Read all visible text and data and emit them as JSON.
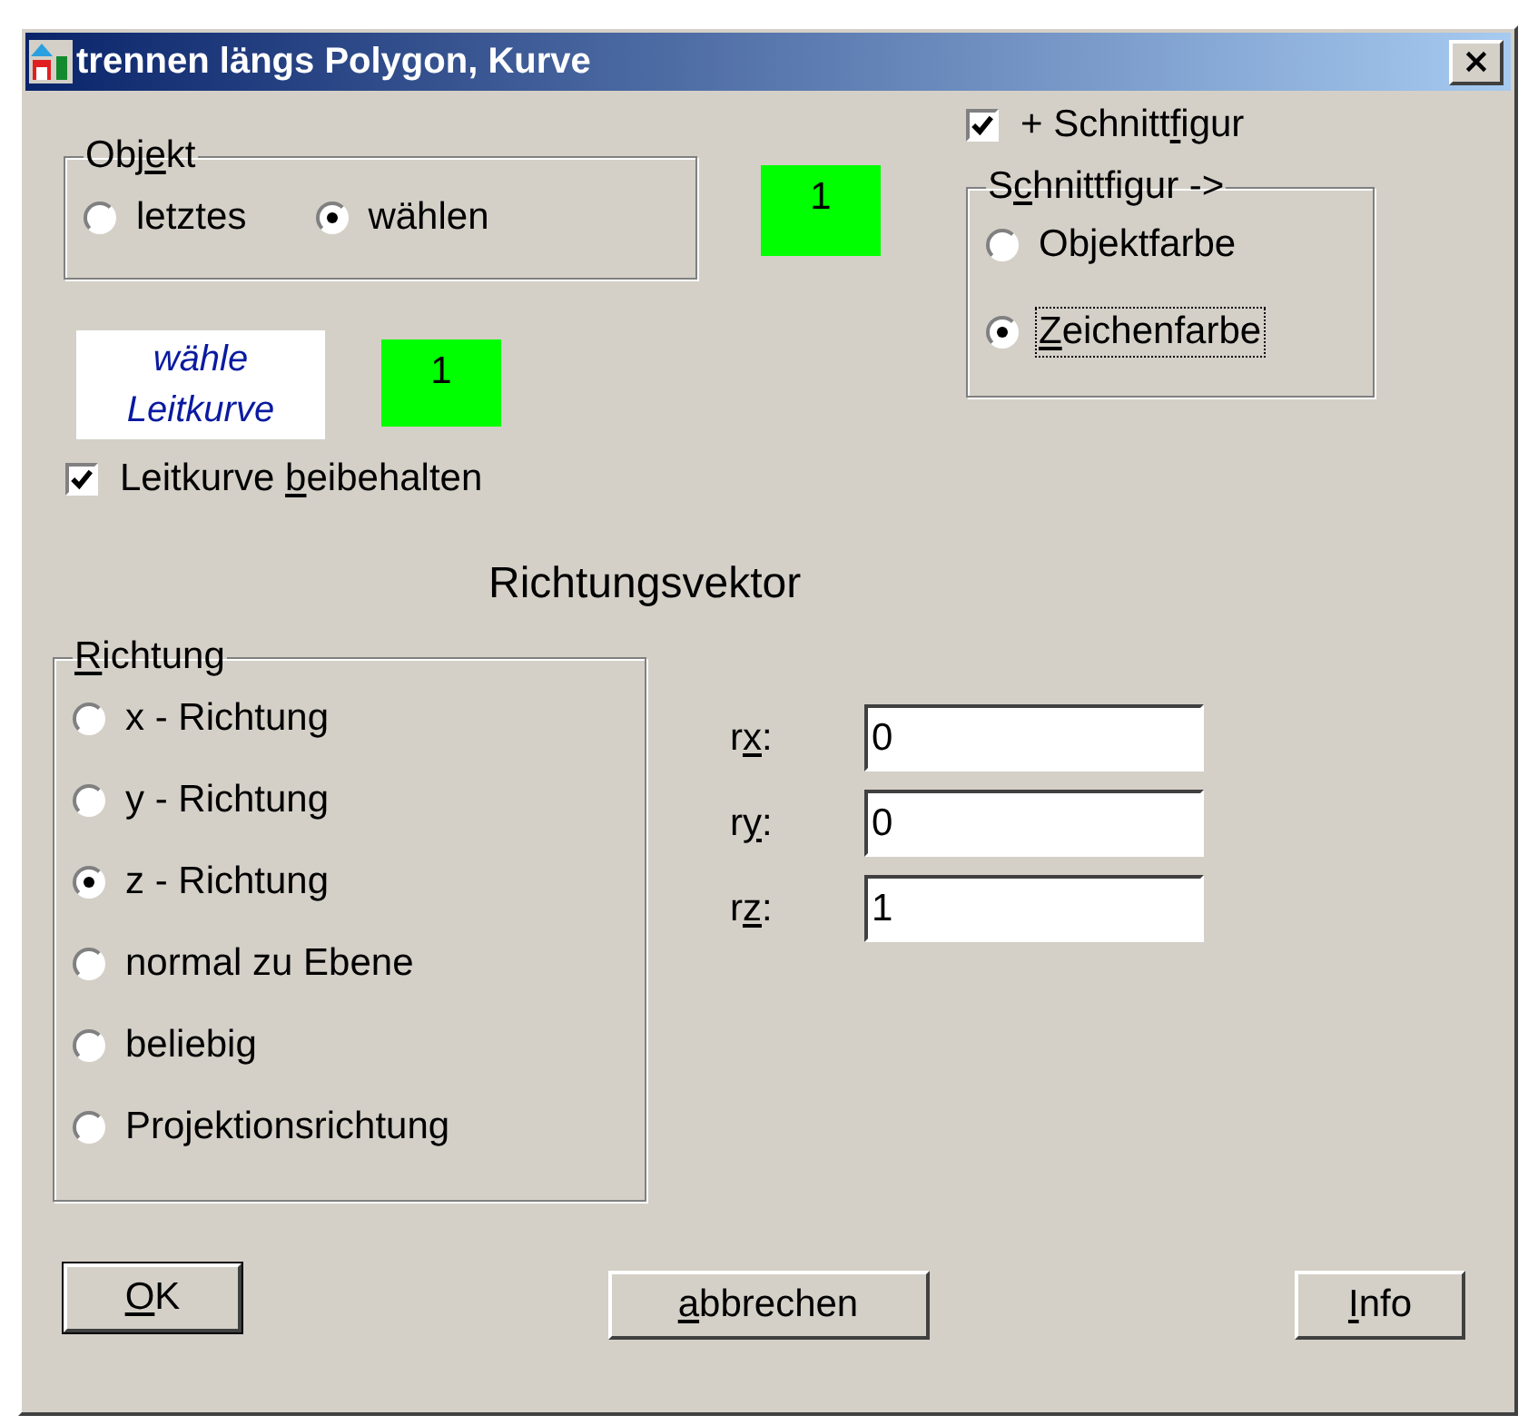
{
  "window": {
    "title": "trennen längs Polygon, Kurve"
  },
  "objekt_group": {
    "label": [
      "Obj",
      "e",
      "kt"
    ],
    "options": [
      {
        "label": "letztes",
        "selected": false
      },
      {
        "label": "wählen",
        "selected": true
      }
    ]
  },
  "objekt_count": "1",
  "leitkurve_prompt": [
    "wähle",
    "Leitkurve"
  ],
  "leitkurve_count": "1",
  "keep_leitkurve": {
    "label": [
      "Leitkurve ",
      "b",
      "eibehalten"
    ],
    "checked": true
  },
  "schnittfigur": {
    "label": [
      "+ Schnitt",
      "f",
      "igur"
    ],
    "checked": true
  },
  "schnittfigur_group": {
    "label": [
      "S",
      "c",
      "hnittfigur ->"
    ],
    "options": [
      {
        "label": "Objektfarbe",
        "selected": false,
        "focused": false
      },
      {
        "label": {
          "key": "Z",
          "after": "eichenfarbe"
        },
        "selected": true,
        "focused": true
      }
    ]
  },
  "heading": "Richtungsvektor",
  "richtung_group": {
    "label": {
      "key": "R",
      "after": "ichtung"
    },
    "options": [
      {
        "label": "x - Richtung",
        "selected": false
      },
      {
        "label": "y - Richtung",
        "selected": false
      },
      {
        "label": "z - Richtung",
        "selected": true
      },
      {
        "label": "normal zu Ebene",
        "selected": false
      },
      {
        "label": "beliebig",
        "selected": false
      },
      {
        "label": "Projektionsrichtung",
        "selected": false
      }
    ]
  },
  "vector_fields": [
    {
      "label": [
        "r",
        "x",
        ":"
      ],
      "value": "0"
    },
    {
      "label": [
        "r",
        "y",
        ":"
      ],
      "value": "0"
    },
    {
      "label": [
        "r",
        "z",
        ":"
      ],
      "value": "1"
    }
  ],
  "buttons": [
    {
      "label": {
        "key": "O",
        "after": "K"
      },
      "default": true
    },
    {
      "label": {
        "key": "a",
        "after": "bbrechen"
      },
      "default": false
    },
    {
      "label": {
        "key": "I",
        "after": "nfo"
      },
      "default": false
    }
  ]
}
